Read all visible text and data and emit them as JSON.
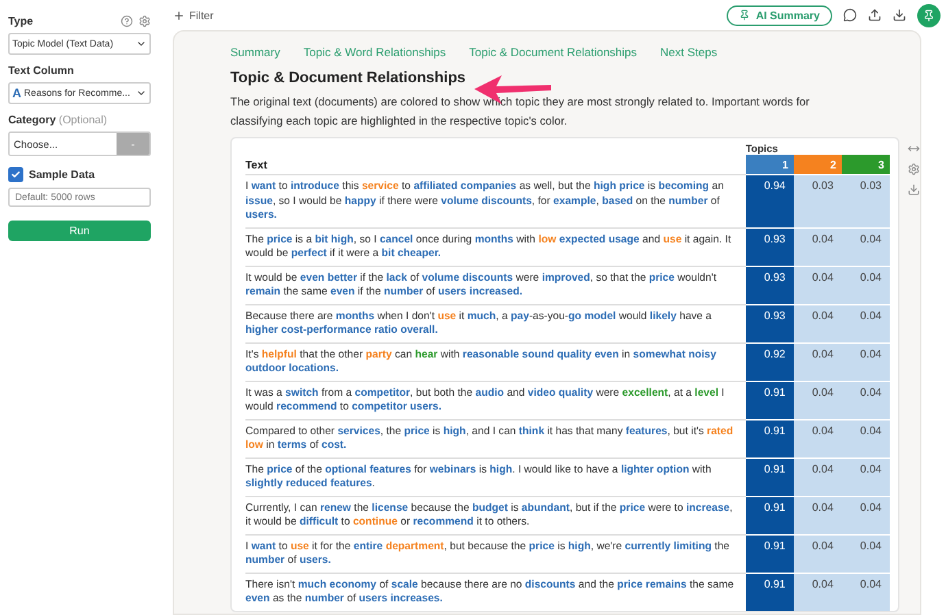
{
  "sidebar": {
    "type_label": "Type",
    "type_value": "Topic Model (Text Data)",
    "text_column_label": "Text Column",
    "text_column_type": "A",
    "text_column_value": "Reasons for Recomme...",
    "category_label": "Category",
    "category_hint": "(Optional)",
    "category_value": "Choose...",
    "category_button": "-",
    "sample_label": "Sample Data",
    "sample_checked": true,
    "sample_placeholder": "Default: 5000 rows",
    "run_button": "Run"
  },
  "toolbar": {
    "filter": "Filter",
    "ai_summary": "AI Summary"
  },
  "nav": [
    {
      "label": "Summary",
      "selected": false
    },
    {
      "label": "Topic & Word Relationships",
      "selected": false
    },
    {
      "label": "Topic & Document Relationships",
      "selected": false
    },
    {
      "label": "Next Steps",
      "selected": false
    }
  ],
  "heading": "Topic & Document Relationships",
  "description": "The original text (documents) are colored to show which topic they are most strongly related to. Important words for classifying each topic are highlighted in the respective topic's color.",
  "table": {
    "text_header": "Text",
    "topics_header": "Topics",
    "topics": [
      {
        "label": "1",
        "color": "#3a7fc0"
      },
      {
        "label": "2",
        "color": "#f5821f"
      },
      {
        "label": "3",
        "color": "#2c9a2c"
      }
    ],
    "rows": [
      {
        "segments": [
          {
            "text": "I "
          },
          {
            "text": "want",
            "color": "#2d6db5"
          },
          {
            "text": " to "
          },
          {
            "text": "introduce",
            "color": "#2d6db5"
          },
          {
            "text": " this "
          },
          {
            "text": "service",
            "color": "#f5821f"
          },
          {
            "text": " to "
          },
          {
            "text": "affiliated companies",
            "color": "#2d6db5"
          },
          {
            "text": " as well, but the "
          },
          {
            "text": "high price",
            "color": "#2d6db5"
          },
          {
            "text": " is "
          },
          {
            "text": "becoming",
            "color": "#2d6db5"
          },
          {
            "text": " an "
          },
          {
            "text": "issue",
            "color": "#2d6db5"
          },
          {
            "text": ", so I would be "
          },
          {
            "text": "happy",
            "color": "#2d6db5"
          },
          {
            "text": " if there were "
          },
          {
            "text": "volume discounts",
            "color": "#2d6db5"
          },
          {
            "text": ", for "
          },
          {
            "text": "example",
            "color": "#2d6db5"
          },
          {
            "text": ", "
          },
          {
            "text": "based",
            "color": "#2d6db5"
          },
          {
            "text": " on the "
          },
          {
            "text": "number",
            "color": "#2d6db5"
          },
          {
            "text": " of "
          },
          {
            "text": "users.",
            "color": "#2d6db5"
          }
        ],
        "values": [
          "0.94",
          "0.03",
          "0.03"
        ]
      },
      {
        "segments": [
          {
            "text": "The "
          },
          {
            "text": "price",
            "color": "#2d6db5"
          },
          {
            "text": " is a "
          },
          {
            "text": "bit high",
            "color": "#2d6db5"
          },
          {
            "text": ", so I "
          },
          {
            "text": "cancel",
            "color": "#2d6db5"
          },
          {
            "text": " once during "
          },
          {
            "text": "months",
            "color": "#2d6db5"
          },
          {
            "text": " with "
          },
          {
            "text": "low ",
            "color": "#f5821f"
          },
          {
            "text": "expected usage",
            "color": "#2d6db5"
          },
          {
            "text": " and "
          },
          {
            "text": "use",
            "color": "#f5821f"
          },
          {
            "text": " it again. It would be "
          },
          {
            "text": "perfect",
            "color": "#2d6db5"
          },
          {
            "text": " if it were a "
          },
          {
            "text": "bit cheaper.",
            "color": "#2d6db5"
          }
        ],
        "values": [
          "0.93",
          "0.04",
          "0.04"
        ]
      },
      {
        "segments": [
          {
            "text": "It would be "
          },
          {
            "text": "even better",
            "color": "#2d6db5"
          },
          {
            "text": " if the "
          },
          {
            "text": "lack",
            "color": "#2d6db5"
          },
          {
            "text": " of "
          },
          {
            "text": "volume discounts",
            "color": "#2d6db5"
          },
          {
            "text": " were "
          },
          {
            "text": "improved",
            "color": "#2d6db5"
          },
          {
            "text": ", so that the "
          },
          {
            "text": "price",
            "color": "#2d6db5"
          },
          {
            "text": " wouldn't "
          },
          {
            "text": "remain",
            "color": "#2d6db5"
          },
          {
            "text": " the same "
          },
          {
            "text": "even",
            "color": "#2d6db5"
          },
          {
            "text": " if the "
          },
          {
            "text": "number",
            "color": "#2d6db5"
          },
          {
            "text": " of "
          },
          {
            "text": "users increased.",
            "color": "#2d6db5"
          }
        ],
        "values": [
          "0.93",
          "0.04",
          "0.04"
        ]
      },
      {
        "segments": [
          {
            "text": "Because there are "
          },
          {
            "text": "months",
            "color": "#2d6db5"
          },
          {
            "text": " when I don't "
          },
          {
            "text": "use",
            "color": "#f5821f"
          },
          {
            "text": " it "
          },
          {
            "text": "much",
            "color": "#2d6db5"
          },
          {
            "text": ", a "
          },
          {
            "text": "pay",
            "color": "#2d6db5"
          },
          {
            "text": "-as-you-"
          },
          {
            "text": "go model",
            "color": "#2d6db5"
          },
          {
            "text": " would "
          },
          {
            "text": "likely",
            "color": "#2d6db5"
          },
          {
            "text": " have a "
          },
          {
            "text": "higher cost-performance ratio overall.",
            "color": "#2d6db5"
          }
        ],
        "values": [
          "0.93",
          "0.04",
          "0.04"
        ]
      },
      {
        "segments": [
          {
            "text": "It's "
          },
          {
            "text": "helpful",
            "color": "#f5821f"
          },
          {
            "text": " that the other "
          },
          {
            "text": "party",
            "color": "#f5821f"
          },
          {
            "text": " can "
          },
          {
            "text": "hear",
            "color": "#2c9a2c"
          },
          {
            "text": " with "
          },
          {
            "text": "reasonable sound quality even",
            "color": "#2d6db5"
          },
          {
            "text": " in "
          },
          {
            "text": "somewhat noisy outdoor locations.",
            "color": "#2d6db5"
          }
        ],
        "values": [
          "0.92",
          "0.04",
          "0.04"
        ]
      },
      {
        "segments": [
          {
            "text": "It was a "
          },
          {
            "text": "switch",
            "color": "#2d6db5"
          },
          {
            "text": " from a "
          },
          {
            "text": "competitor",
            "color": "#2d6db5"
          },
          {
            "text": ", but both the "
          },
          {
            "text": "audio",
            "color": "#2d6db5"
          },
          {
            "text": " and "
          },
          {
            "text": "video quality",
            "color": "#2d6db5"
          },
          {
            "text": " were "
          },
          {
            "text": "excellent",
            "color": "#2c9a2c"
          },
          {
            "text": ", at a "
          },
          {
            "text": "level",
            "color": "#2c9a2c"
          },
          {
            "text": " I would "
          },
          {
            "text": "recommend",
            "color": "#2d6db5"
          },
          {
            "text": " to "
          },
          {
            "text": "competitor users.",
            "color": "#2d6db5"
          }
        ],
        "values": [
          "0.91",
          "0.04",
          "0.04"
        ]
      },
      {
        "segments": [
          {
            "text": "Compared to other "
          },
          {
            "text": "services",
            "color": "#2d6db5"
          },
          {
            "text": ", the "
          },
          {
            "text": "price",
            "color": "#2d6db5"
          },
          {
            "text": " is "
          },
          {
            "text": "high",
            "color": "#2d6db5"
          },
          {
            "text": ", and I can "
          },
          {
            "text": "think",
            "color": "#2d6db5"
          },
          {
            "text": " it has that many "
          },
          {
            "text": "features",
            "color": "#2d6db5"
          },
          {
            "text": ", but it's "
          },
          {
            "text": "rated low",
            "color": "#f5821f"
          },
          {
            "text": " in "
          },
          {
            "text": "terms",
            "color": "#2d6db5"
          },
          {
            "text": " of "
          },
          {
            "text": "cost.",
            "color": "#2d6db5"
          }
        ],
        "values": [
          "0.91",
          "0.04",
          "0.04"
        ]
      },
      {
        "segments": [
          {
            "text": "The "
          },
          {
            "text": "price",
            "color": "#2d6db5"
          },
          {
            "text": " of the "
          },
          {
            "text": "optional features",
            "color": "#2d6db5"
          },
          {
            "text": " for "
          },
          {
            "text": "webinars",
            "color": "#2d6db5"
          },
          {
            "text": " is "
          },
          {
            "text": "high",
            "color": "#2d6db5"
          },
          {
            "text": ". I would like to have a "
          },
          {
            "text": "lighter option",
            "color": "#2d6db5"
          },
          {
            "text": " with "
          },
          {
            "text": "slightly reduced features",
            "color": "#2d6db5"
          },
          {
            "text": "."
          }
        ],
        "values": [
          "0.91",
          "0.04",
          "0.04"
        ]
      },
      {
        "segments": [
          {
            "text": "Currently, I can "
          },
          {
            "text": "renew",
            "color": "#2d6db5"
          },
          {
            "text": " the "
          },
          {
            "text": "license",
            "color": "#2d6db5"
          },
          {
            "text": " because the "
          },
          {
            "text": "budget",
            "color": "#2d6db5"
          },
          {
            "text": " is "
          },
          {
            "text": "abundant",
            "color": "#2d6db5"
          },
          {
            "text": ", but if the "
          },
          {
            "text": "price",
            "color": "#2d6db5"
          },
          {
            "text": " were to "
          },
          {
            "text": "increase",
            "color": "#2d6db5"
          },
          {
            "text": ", it would be "
          },
          {
            "text": "difficult",
            "color": "#2d6db5"
          },
          {
            "text": " to "
          },
          {
            "text": "continue",
            "color": "#f5821f"
          },
          {
            "text": " or "
          },
          {
            "text": "recommend",
            "color": "#2d6db5"
          },
          {
            "text": " it to others."
          }
        ],
        "values": [
          "0.91",
          "0.04",
          "0.04"
        ]
      },
      {
        "segments": [
          {
            "text": "I "
          },
          {
            "text": "want",
            "color": "#2d6db5"
          },
          {
            "text": " to "
          },
          {
            "text": "use",
            "color": "#f5821f"
          },
          {
            "text": " it for the "
          },
          {
            "text": "entire ",
            "color": "#2d6db5"
          },
          {
            "text": "department",
            "color": "#f5821f"
          },
          {
            "text": ", but because the "
          },
          {
            "text": "price",
            "color": "#2d6db5"
          },
          {
            "text": " is "
          },
          {
            "text": "high",
            "color": "#2d6db5"
          },
          {
            "text": ", we're "
          },
          {
            "text": "currently limiting",
            "color": "#2d6db5"
          },
          {
            "text": " the "
          },
          {
            "text": "number",
            "color": "#2d6db5"
          },
          {
            "text": " of "
          },
          {
            "text": "users.",
            "color": "#2d6db5"
          }
        ],
        "values": [
          "0.91",
          "0.04",
          "0.04"
        ]
      },
      {
        "segments": [
          {
            "text": "There isn't "
          },
          {
            "text": "much economy",
            "color": "#2d6db5"
          },
          {
            "text": " of "
          },
          {
            "text": "scale",
            "color": "#2d6db5"
          },
          {
            "text": " because there are no "
          },
          {
            "text": "discounts",
            "color": "#2d6db5"
          },
          {
            "text": " and the "
          },
          {
            "text": "price remains",
            "color": "#2d6db5"
          },
          {
            "text": " the same "
          },
          {
            "text": "even",
            "color": "#2d6db5"
          },
          {
            "text": " as the "
          },
          {
            "text": "number",
            "color": "#2d6db5"
          },
          {
            "text": " of "
          },
          {
            "text": "users increases.",
            "color": "#2d6db5"
          }
        ],
        "values": [
          "0.91",
          "0.04",
          "0.04"
        ]
      }
    ]
  }
}
